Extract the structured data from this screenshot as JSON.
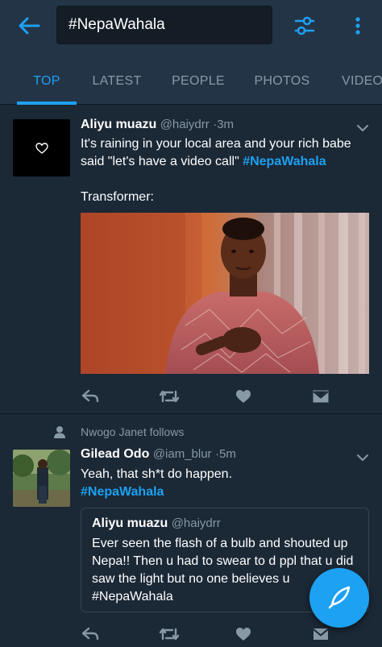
{
  "search": {
    "query": "#NepaWahala"
  },
  "tabs": [
    {
      "label": "TOP",
      "active": true
    },
    {
      "label": "LATEST",
      "active": false
    },
    {
      "label": "PEOPLE",
      "active": false
    },
    {
      "label": "PHOTOS",
      "active": false
    },
    {
      "label": "VIDEOS",
      "active": false
    }
  ],
  "tweets": [
    {
      "name": "Aliyu muazu",
      "handle": "@haiydrr",
      "time": "3m",
      "text_lines": [
        "It's raining in your local area and your rich babe",
        "said \"let's have a video call\""
      ],
      "hashtag": "#NepaWahala",
      "caption": "Transformer:"
    },
    {
      "social_context": "Nwogo Janet follows",
      "name": "Gilead Odo",
      "handle": "@iam_blur",
      "time": "5m",
      "text": "Yeah, that sh*t do happen.",
      "hashtag": "#NepaWahala",
      "quote": {
        "name": "Aliyu muazu",
        "handle": "@haiydrr",
        "text": "Ever seen the flash of a bulb and shouted up Nepa!! Then u had to swear to d ppl that u did saw the light but no one believes u #NepaWahala"
      }
    }
  ],
  "colors": {
    "accent": "#1da1f2",
    "background": "#1b2836",
    "header": "#243447",
    "muted": "#8899a6"
  },
  "icons": [
    "back-arrow-icon",
    "filter-icon",
    "more-vertical-icon",
    "chevron-down-icon",
    "reply-icon",
    "retweet-icon",
    "like-icon",
    "direct-message-icon",
    "person-icon",
    "compose-icon"
  ]
}
